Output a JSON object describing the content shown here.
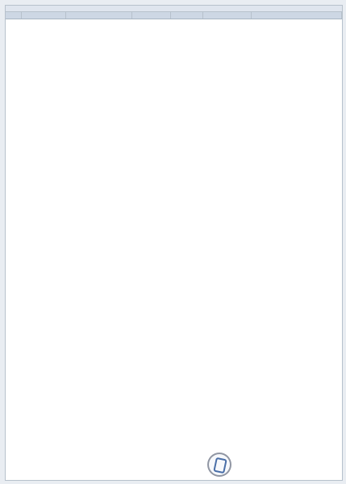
{
  "sheet": {
    "title": "",
    "columns": [
      "",
      "",
      "",
      "",
      "",
      "",
      ""
    ]
  },
  "rows": [],
  "watermark": {
    "text": ""
  },
  "colors": {
    "positive_text": "#d03a3a",
    "group_text": "#3d8bd6",
    "negative_text": "#9c2f2f",
    "header_bg": "#cdd7e4",
    "title_bg": "#dfe5ee"
  }
}
